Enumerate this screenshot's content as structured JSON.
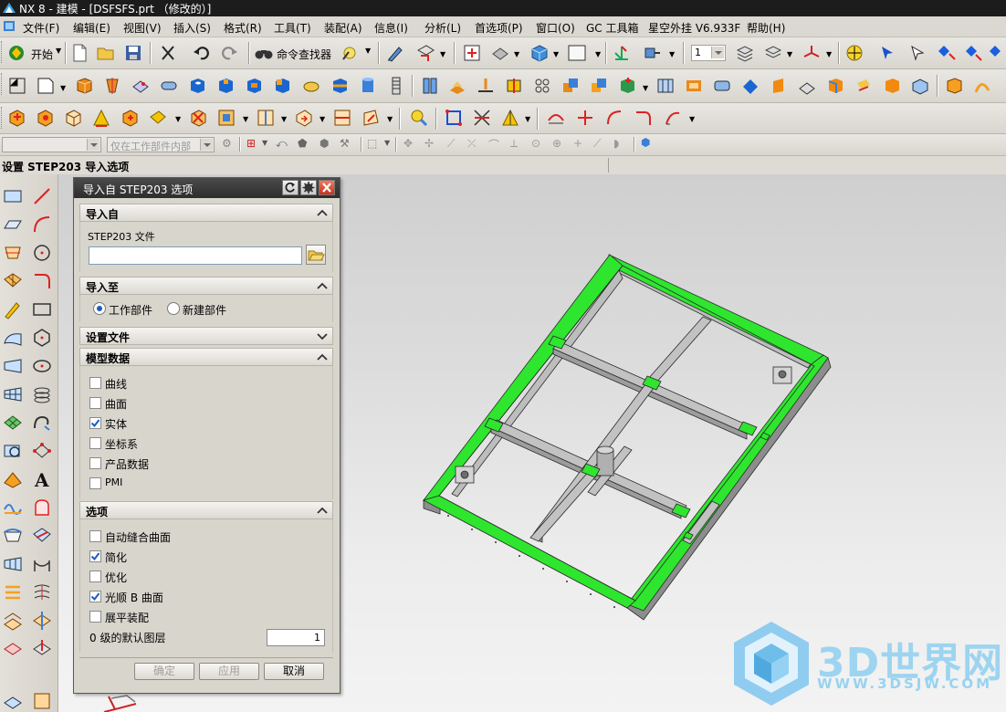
{
  "app": {
    "title": "NX 8 - 建模 - [DSFSFS.prt （修改的）]"
  },
  "menu": {
    "items": [
      "文件(F)",
      "编辑(E)",
      "视图(V)",
      "插入(S)",
      "格式(R)",
      "工具(T)",
      "装配(A)",
      "信息(I)",
      "分析(L)",
      "首选项(P)",
      "窗口(O)",
      "GC 工具箱",
      "星空外挂 V6.933F",
      "帮助(H)"
    ]
  },
  "toolbar": {
    "start_label": "开始",
    "cmd_finder_label": "命令查找器",
    "layer_value": "1"
  },
  "filterbar": {
    "type_filter": "",
    "scope_filter": "仅在工作部件内部"
  },
  "cue": {
    "text": "设置 STEP203 导入选项"
  },
  "dialog": {
    "title": "导入自 STEP203 选项",
    "sections": {
      "import_from": {
        "title": "导入自",
        "file_label": "STEP203 文件",
        "file_value": ""
      },
      "import_to": {
        "title": "导入至",
        "options": [
          {
            "label": "工作部件",
            "selected": true
          },
          {
            "label": "新建部件",
            "selected": false
          }
        ]
      },
      "settings_file": {
        "title": "设置文件"
      },
      "model_data": {
        "title": "模型数据",
        "items": [
          {
            "label": "曲线",
            "checked": false
          },
          {
            "label": "曲面",
            "checked": false
          },
          {
            "label": "实体",
            "checked": true
          },
          {
            "label": "坐标系",
            "checked": false
          },
          {
            "label": "产品数据",
            "checked": false
          },
          {
            "label": "PMI",
            "checked": false
          }
        ]
      },
      "options": {
        "title": "选项",
        "items": [
          {
            "label": "自动缝合曲面",
            "checked": false
          },
          {
            "label": "简化",
            "checked": true
          },
          {
            "label": "优化",
            "checked": false
          },
          {
            "label": "光顺 B 曲面",
            "checked": true
          },
          {
            "label": "展平装配",
            "checked": false
          }
        ],
        "default_layer_label": "0 级的默认图层",
        "default_layer_value": "1"
      }
    },
    "buttons": {
      "ok": "确定",
      "apply": "应用",
      "cancel": "取消"
    }
  },
  "watermark": {
    "brand": "3D世界网",
    "url": "WWW.3DSJW.COM"
  },
  "colors": {
    "frame_green": "#2ee62e",
    "beam_gray": "#b8b8b8",
    "title_bar": "#1c1c1c",
    "dialog_bg": "#d8d5cd"
  }
}
